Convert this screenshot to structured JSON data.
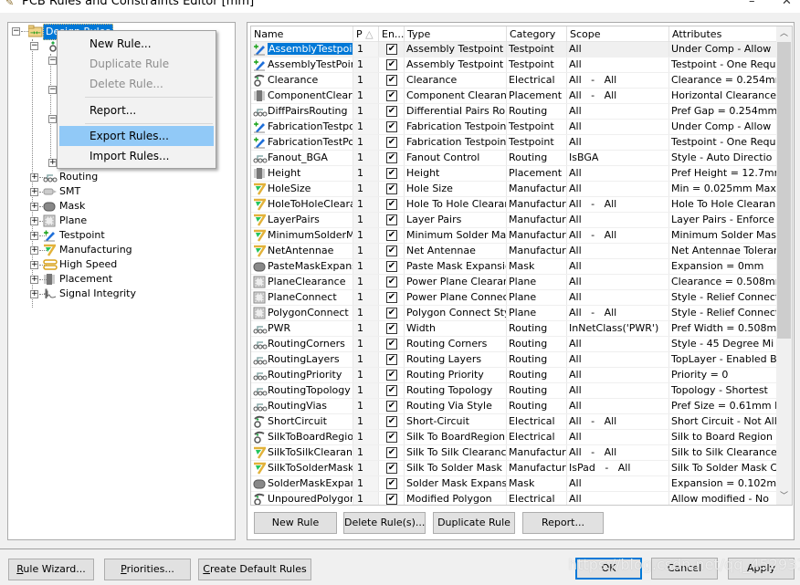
{
  "window": {
    "title": "PCB Rules and Constraints Editor [mm]",
    "controls": {
      "minimize": "–",
      "close": "✕"
    }
  },
  "tree": {
    "root": {
      "label": "Design Rules",
      "icon": "design-rules-folder-icon",
      "selected": true
    },
    "categories": [
      {
        "label": "Routing",
        "icon": "routing-icon"
      },
      {
        "label": "SMT",
        "icon": "smt-icon"
      },
      {
        "label": "Mask",
        "icon": "mask-icon"
      },
      {
        "label": "Plane",
        "icon": "plane-icon"
      },
      {
        "label": "Testpoint",
        "icon": "testpoint-icon"
      },
      {
        "label": "Manufacturing",
        "icon": "manufacturing-icon"
      },
      {
        "label": "High Speed",
        "icon": "high-speed-icon"
      },
      {
        "label": "Placement",
        "icon": "placement-icon"
      },
      {
        "label": "Signal Integrity",
        "icon": "signal-integrity-icon"
      }
    ]
  },
  "context_menu": {
    "items": [
      {
        "label": "New Rule...",
        "enabled": true
      },
      {
        "label": "Duplicate Rule",
        "enabled": false
      },
      {
        "label": "Delete Rule...",
        "enabled": false
      },
      {
        "label": "Report...",
        "enabled": true
      },
      {
        "label": "Export Rules...",
        "enabled": true,
        "highlighted": true
      },
      {
        "label": "Import Rules...",
        "enabled": true
      }
    ]
  },
  "grid": {
    "columns": [
      "Name",
      "P",
      "En...",
      "Type",
      "Category",
      "Scope",
      "Attributes"
    ],
    "sort_indicator": "△",
    "rows": [
      {
        "icon": "testpoint",
        "name": "AssemblyTestpoint",
        "priority": "1",
        "enabled": true,
        "type": "Assembly Testpoint S",
        "category": "Testpoint",
        "scope": "All",
        "attributes": "Under Comp - Allow"
      },
      {
        "icon": "testpoint",
        "name": "AssemblyTestPoint",
        "priority": "1",
        "enabled": true,
        "type": "Assembly Testpoint U",
        "category": "Testpoint",
        "scope": "All",
        "attributes": "Testpoint - One Requ"
      },
      {
        "icon": "electrical",
        "name": "Clearance",
        "priority": "1",
        "enabled": true,
        "type": "Clearance",
        "category": "Electrical",
        "scope": "All   -   All",
        "attributes": "Clearance = 0.254mm"
      },
      {
        "icon": "placement",
        "name": "ComponentCleara",
        "priority": "1",
        "enabled": true,
        "type": "Component Clearanc",
        "category": "Placement",
        "scope": "All   -   All",
        "attributes": "Horizontal Clearance"
      },
      {
        "icon": "routing",
        "name": "DiffPairsRouting",
        "priority": "1",
        "enabled": true,
        "type": "Differential Pairs Rou",
        "category": "Routing",
        "scope": "All",
        "attributes": "Pref Gap = 0.254mm"
      },
      {
        "icon": "testpoint",
        "name": "FabricationTestpo",
        "priority": "1",
        "enabled": true,
        "type": "Fabrication Testpoint",
        "category": "Testpoint",
        "scope": "All",
        "attributes": "Under Comp - Allow"
      },
      {
        "icon": "testpoint",
        "name": "FabricationTestPoi",
        "priority": "1",
        "enabled": true,
        "type": "Fabrication Testpoint",
        "category": "Testpoint",
        "scope": "All",
        "attributes": "Testpoint - One Requ"
      },
      {
        "icon": "routing",
        "name": "Fanout_BGA",
        "priority": "1",
        "enabled": true,
        "type": "Fanout Control",
        "category": "Routing",
        "scope": "IsBGA",
        "attributes": "Style - Auto   Directio"
      },
      {
        "icon": "placement",
        "name": "Height",
        "priority": "1",
        "enabled": true,
        "type": "Height",
        "category": "Placement",
        "scope": "All",
        "attributes": "Pref Height = 12.7mm"
      },
      {
        "icon": "manufacturing",
        "name": "HoleSize",
        "priority": "1",
        "enabled": true,
        "type": "Hole Size",
        "category": "Manufacturi",
        "scope": "All",
        "attributes": "Min = 0.025mm    Max"
      },
      {
        "icon": "manufacturing",
        "name": "HoleToHoleCleara",
        "priority": "1",
        "enabled": true,
        "type": "Hole To Hole Clearan",
        "category": "Manufacturi",
        "scope": "All   -   All",
        "attributes": "Hole To Hole Clearan"
      },
      {
        "icon": "manufacturing",
        "name": "LayerPairs",
        "priority": "1",
        "enabled": true,
        "type": "Layer Pairs",
        "category": "Manufacturi",
        "scope": "All",
        "attributes": "Layer Pairs - Enforce"
      },
      {
        "icon": "manufacturing",
        "name": "MinimumSolderMa",
        "priority": "1",
        "enabled": true,
        "type": "Minimum Solder Mas",
        "category": "Manufacturi",
        "scope": "All   -   All",
        "attributes": "Minimum Solder Mask"
      },
      {
        "icon": "manufacturing",
        "name": "NetAntennae",
        "priority": "1",
        "enabled": true,
        "type": "Net Antennae",
        "category": "Manufacturi",
        "scope": "All",
        "attributes": "Net Antennae Tolerar"
      },
      {
        "icon": "mask",
        "name": "PasteMaskExpansi",
        "priority": "1",
        "enabled": true,
        "type": "Paste Mask Expansior",
        "category": "Mask",
        "scope": "All",
        "attributes": "Expansion = 0mm"
      },
      {
        "icon": "plane",
        "name": "PlaneClearance",
        "priority": "1",
        "enabled": true,
        "type": "Power Plane Clearanc",
        "category": "Plane",
        "scope": "All",
        "attributes": "Clearance = 0.508mm"
      },
      {
        "icon": "plane",
        "name": "PlaneConnect",
        "priority": "1",
        "enabled": true,
        "type": "Power Plane Connect",
        "category": "Plane",
        "scope": "All",
        "attributes": "Style - Relief Connect"
      },
      {
        "icon": "plane",
        "name": "PolygonConnect",
        "priority": "1",
        "enabled": true,
        "type": "Polygon Connect Styl",
        "category": "Plane",
        "scope": "All   -   All",
        "attributes": "Style - Relief Connect"
      },
      {
        "icon": "routing",
        "name": "PWR",
        "priority": "1",
        "enabled": true,
        "type": "Width",
        "category": "Routing",
        "scope": "InNetClass('PWR')",
        "attributes": "Pref Width = 0.508mm"
      },
      {
        "icon": "routing",
        "name": "RoutingCorners",
        "priority": "1",
        "enabled": true,
        "type": "Routing Corners",
        "category": "Routing",
        "scope": "All",
        "attributes": "Style - 45 Degree   Mi"
      },
      {
        "icon": "routing",
        "name": "RoutingLayers",
        "priority": "1",
        "enabled": true,
        "type": "Routing Layers",
        "category": "Routing",
        "scope": "All",
        "attributes": "TopLayer - Enabled Bo"
      },
      {
        "icon": "routing",
        "name": "RoutingPriority",
        "priority": "1",
        "enabled": true,
        "type": "Routing Priority",
        "category": "Routing",
        "scope": "All",
        "attributes": "Priority = 0"
      },
      {
        "icon": "routing",
        "name": "RoutingTopology",
        "priority": "1",
        "enabled": true,
        "type": "Routing Topology",
        "category": "Routing",
        "scope": "All",
        "attributes": "Topology - Shortest"
      },
      {
        "icon": "routing",
        "name": "RoutingVias",
        "priority": "1",
        "enabled": true,
        "type": "Routing Via Style",
        "category": "Routing",
        "scope": "All",
        "attributes": "Pref Size = 0.61mm    I"
      },
      {
        "icon": "electrical",
        "name": "ShortCircuit",
        "priority": "1",
        "enabled": true,
        "type": "Short-Circuit",
        "category": "Electrical",
        "scope": "All   -   All",
        "attributes": "Short Circuit - Not All"
      },
      {
        "icon": "electrical",
        "name": "SilkToBoardRegion",
        "priority": "1",
        "enabled": true,
        "type": "Silk To BoardRegion",
        "category": "Electrical",
        "scope": "All",
        "attributes": "Silk to Board Region"
      },
      {
        "icon": "manufacturing",
        "name": "SilkToSilkClearanc",
        "priority": "1",
        "enabled": true,
        "type": "Silk To Silk Clearance",
        "category": "Manufacturi",
        "scope": "All   -   All",
        "attributes": "Silk to Silk Clearance"
      },
      {
        "icon": "manufacturing",
        "name": "SilkToSolderMask(",
        "priority": "1",
        "enabled": true,
        "type": "Silk To Solder Mask C",
        "category": "Manufacturi",
        "scope": "IsPad   -   All",
        "attributes": "Silk To Solder Mask C"
      },
      {
        "icon": "mask",
        "name": "SolderMaskExpans",
        "priority": "1",
        "enabled": true,
        "type": "Solder Mask Expansic",
        "category": "Mask",
        "scope": "All",
        "attributes": "Expansion = 0.102mm"
      },
      {
        "icon": "electrical",
        "name": "UnpouredPolygon",
        "priority": "1",
        "enabled": true,
        "type": "Modified Polygon",
        "category": "Electrical",
        "scope": "All",
        "attributes": "Allow modified - No"
      }
    ]
  },
  "grid_buttons": {
    "new_rule": "New Rule",
    "delete_rules": "Delete Rule(s)...",
    "duplicate_rule": "Duplicate Rule",
    "report": "Report..."
  },
  "footer": {
    "rule_wizard": {
      "accel": "R",
      "rest": "ule Wizard..."
    },
    "priorities": {
      "accel": "P",
      "rest": "riorities..."
    },
    "create_default": {
      "accel": "C",
      "rest": "reate Default Rules"
    },
    "ok": "OK",
    "cancel": "Cancel",
    "apply": "Apply"
  },
  "watermark": "https://blog.csdn.net/qq_45293176",
  "colors": {
    "selection": "#0078d7",
    "menu_highlight": "#91c9f7",
    "default_button_border": "#0078d7"
  }
}
